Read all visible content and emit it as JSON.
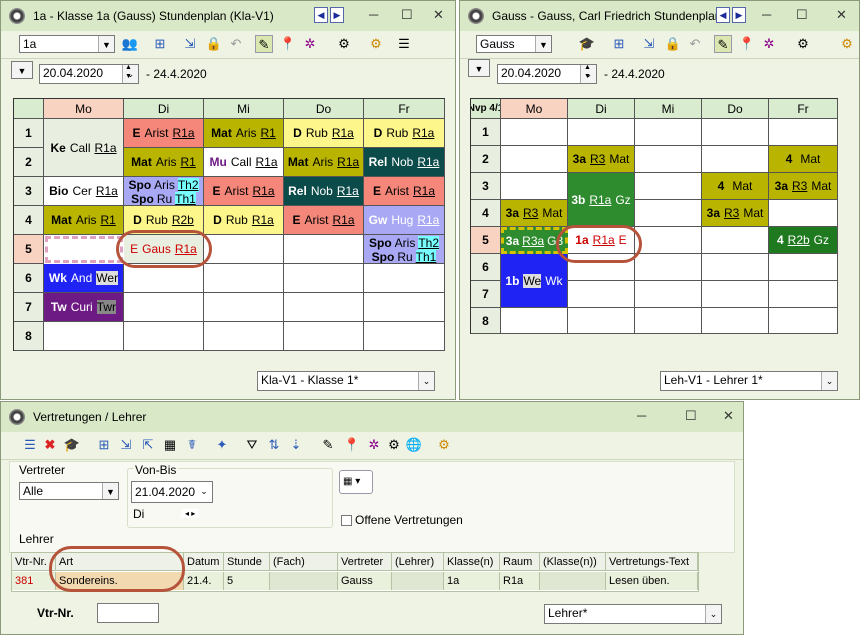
{
  "win1": {
    "title": "1a - Klasse 1a (Gauss)  Stundenplan  (Kla-V1)",
    "class_select": "1a",
    "date": "20.04.2020",
    "date_end": "- 24.4.2020",
    "days": [
      "Mo",
      "Di",
      "Mi",
      "Do",
      "Fr"
    ],
    "periods": [
      "1",
      "2",
      "3",
      "4",
      "5",
      "6",
      "7",
      "8"
    ],
    "format_select": "Kla-V1 - Klasse 1*",
    "cells": {
      "mo12": {
        "a": "Ke",
        "b": "Call",
        "c": "R1a"
      },
      "mo34a": {
        "a": "Bio",
        "b": "Cer",
        "c": "R1a"
      },
      "mo4": {
        "a": "Mat",
        "b": "Aris",
        "c": "R1"
      },
      "mo6": {
        "a": "Wk",
        "b": "And",
        "c": "Wer"
      },
      "mo7": {
        "a": "Tw",
        "b": "Curi",
        "c": "Twr"
      },
      "di1": {
        "a": "E",
        "b": "Arist",
        "c": "R1a"
      },
      "di2": {
        "a": "Mat",
        "b": "Aris",
        "c": "R1"
      },
      "di3a": {
        "a": "Spo",
        "b": "Aris",
        "c": "Th2"
      },
      "di3b": {
        "a": "Spo",
        "b": "Ru",
        "c": "Th1"
      },
      "di4": {
        "a": "D",
        "b": "Rub",
        "c": "R2b"
      },
      "di5": {
        "a": "E",
        "b": "Gaus",
        "c": "R1a"
      },
      "mi1": {
        "a": "Mat",
        "b": "Aris",
        "c": "R1"
      },
      "mi2": {
        "a": "Mu",
        "b": "Call",
        "c": "R1a"
      },
      "mi3": {
        "a": "E",
        "b": "Arist",
        "c": "R1a"
      },
      "mi4": {
        "a": "D",
        "b": "Rub",
        "c": "R1a"
      },
      "do1": {
        "a": "D",
        "b": "Rub",
        "c": "R1a"
      },
      "do2": {
        "a": "Mat",
        "b": "Aris",
        "c": "R1a"
      },
      "do3": {
        "a": "Rel",
        "b": "Nob",
        "c": "R1a"
      },
      "do4": {
        "a": "E",
        "b": "Arist",
        "c": "R1a"
      },
      "fr1": {
        "a": "D",
        "b": "Rub",
        "c": "R1a"
      },
      "fr2": {
        "a": "Rel",
        "b": "Nob",
        "c": "R1a"
      },
      "fr3": {
        "a": "E",
        "b": "Arist",
        "c": "R1a"
      },
      "fr4": {
        "a": "Gw",
        "b": "Hug",
        "c": "R1a"
      },
      "fr5a": {
        "a": "Spo",
        "b": "Aris",
        "c": "Th2"
      },
      "fr5b": {
        "a": "Spo",
        "b": "Ru",
        "c": "Th1"
      }
    }
  },
  "win2": {
    "title": "Gauss - Gauss, Carl Friedrich  Stundenplan",
    "teacher_select": "Gauss",
    "date": "20.04.2020",
    "date_end": "- 24.4.2020",
    "corner": "Nvp 4/1",
    "days": [
      "Mo",
      "Di",
      "Mi",
      "Do",
      "Fr"
    ],
    "periods": [
      "1",
      "2",
      "3",
      "4",
      "5",
      "6",
      "7",
      "8"
    ],
    "format_select": "Leh-V1 - Lehrer 1*",
    "cells": {
      "di2": {
        "a": "3a",
        "b": "R3",
        "c": "Mat"
      },
      "di34": {
        "a": "3b",
        "b": "R1a",
        "c": "Gz"
      },
      "di5": {
        "a": "1a",
        "b": "R1a",
        "c": "E"
      },
      "mo4": {
        "a": "3a",
        "b": "R3",
        "c": "Mat"
      },
      "mo5": {
        "a": "3a",
        "b": "R3a",
        "c": "G3"
      },
      "mo67": {
        "a": "1b",
        "b": "We",
        "c": "Wk"
      },
      "do3": {
        "a": "4",
        "b": "",
        "c": "Mat"
      },
      "do4": {
        "a": "3a",
        "b": "R3",
        "c": "Mat"
      },
      "fr2": {
        "a": "4",
        "b": "",
        "c": "Mat"
      },
      "fr3": {
        "a": "3a",
        "b": "R3",
        "c": "Mat"
      },
      "fr5": {
        "a": "4",
        "b": "R2b",
        "c": "Gz"
      }
    }
  },
  "win3": {
    "title": "Vertretungen / Lehrer",
    "vertreter_label": "Vertreter",
    "vertreter_value": "Alle",
    "vonbis_label": "Von-Bis",
    "vonbis_value": "21.04.2020",
    "day_label": "Di",
    "offene_label": "Offene Vertretungen",
    "lehrer_label": "Lehrer",
    "columns": [
      "Vtr-Nr.",
      "Art",
      "Datum",
      "Stunde",
      "(Fach)",
      "Vertreter",
      "(Lehrer)",
      "Klasse(n)",
      "Raum",
      "(Klasse(n))",
      "Vertretungs-Text"
    ],
    "row": [
      "381",
      "Sondereins.",
      "21.4.",
      "5",
      "",
      "Gauss",
      "",
      "1a",
      "R1a",
      "",
      "Lesen üben."
    ],
    "vtrnr_label": "Vtr-Nr.",
    "format_select": "Lehrer*"
  },
  "colors": {
    "subject_red": "#f4877a",
    "subject_olive": "#b8b400",
    "subject_yellow": "#fdf68a",
    "subject_darkteal": "#0b4c4a",
    "subject_blue": "#1f24f4",
    "subject_purple": "#6d1a84",
    "subject_lavender": "#a8a8f4",
    "subject_green": "#2e8b2e",
    "highlight_oval": "#b5533b"
  }
}
